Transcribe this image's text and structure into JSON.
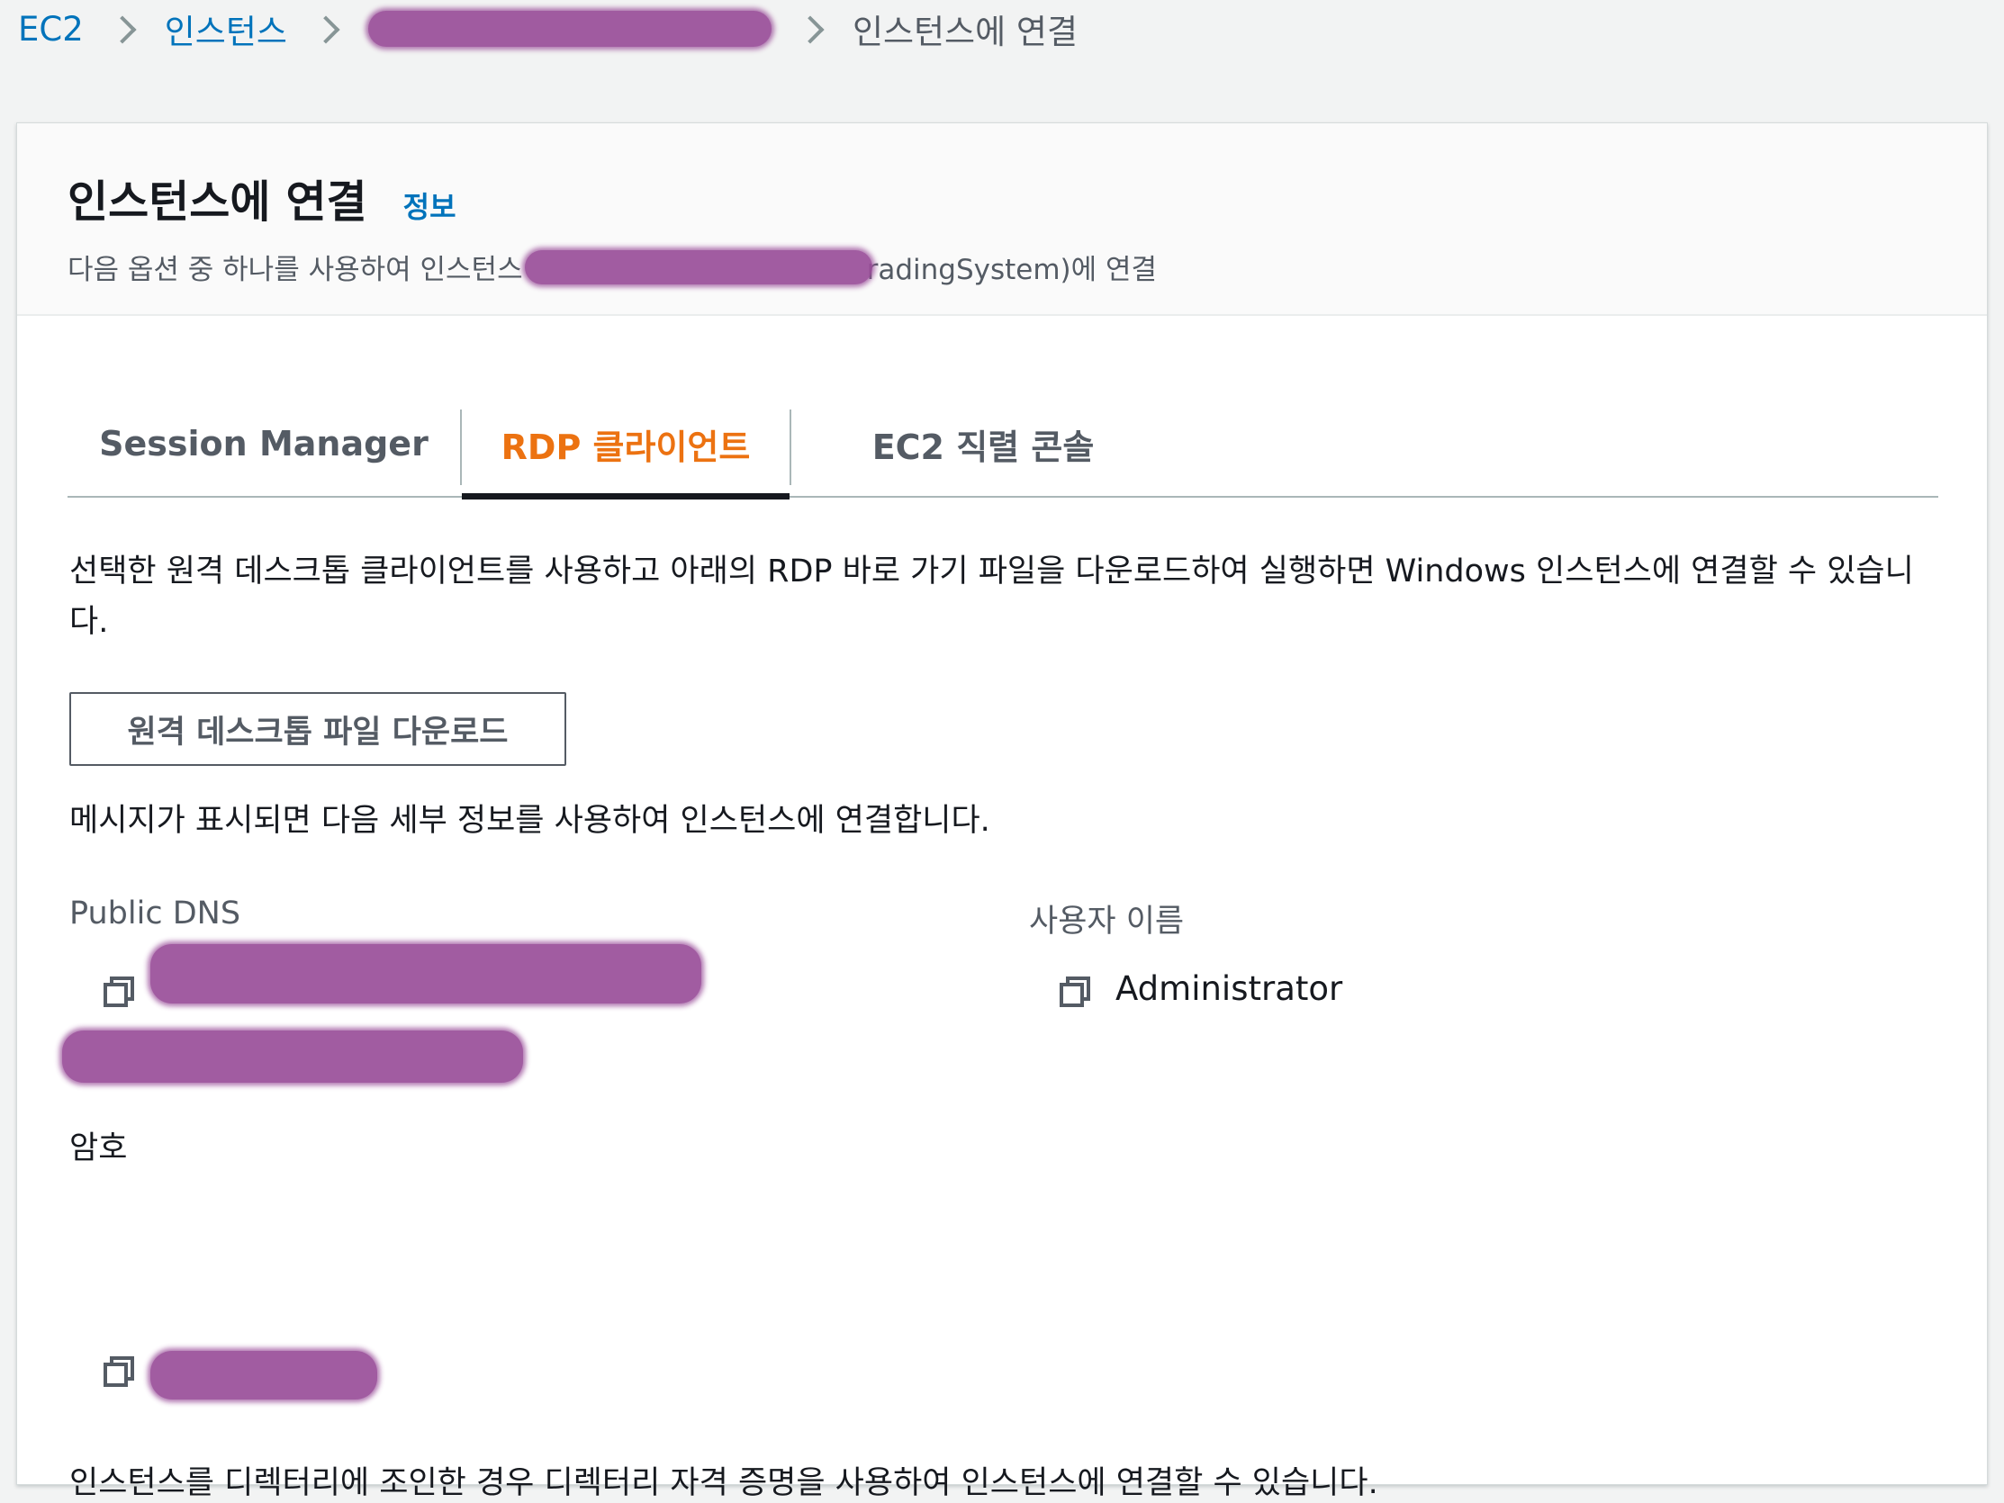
{
  "breadcrumb": {
    "items": [
      {
        "label": "EC2"
      },
      {
        "label": "인스턴스"
      },
      {
        "label": "인스턴스에 연결"
      }
    ]
  },
  "header": {
    "title": "인스턴스에 연결",
    "info_link": "정보",
    "subtitle_prefix": "다음 옵션 중 하나를 사용하여 인스턴스",
    "subtitle_suffix": "radingSystem)에 연결"
  },
  "tabs": [
    {
      "label": "Session Manager",
      "selected": false
    },
    {
      "label": "RDP 클라이언트",
      "selected": true
    },
    {
      "label": "EC2 직렬 콘솔",
      "selected": false
    }
  ],
  "rdp": {
    "description": "선택한 원격 데스크톱 클라이언트를 사용하고 아래의 RDP 바로 가기 파일을 다운로드하여 실행하면 Windows 인스턴스에 연결할 수 있습니다.",
    "download_button": "원격 데스크톱 파일 다운로드",
    "prompt_text": "메시지가 표시되면 다음 세부 정보를 사용하여 인스턴스에 연결합니다.",
    "public_dns_label": "Public DNS",
    "username_label": "사용자 이름",
    "username_value": "Administrator",
    "password_label": "암호",
    "footer_text": "인스턴스를 디렉터리에 조인한 경우 디렉터리 자격 증명을 사용하여 인스턴스에 연결할 수 있습니다."
  },
  "colors": {
    "link": "#0073bb",
    "active_tab": "#ec7211",
    "redaction": "#9a4f9a"
  }
}
